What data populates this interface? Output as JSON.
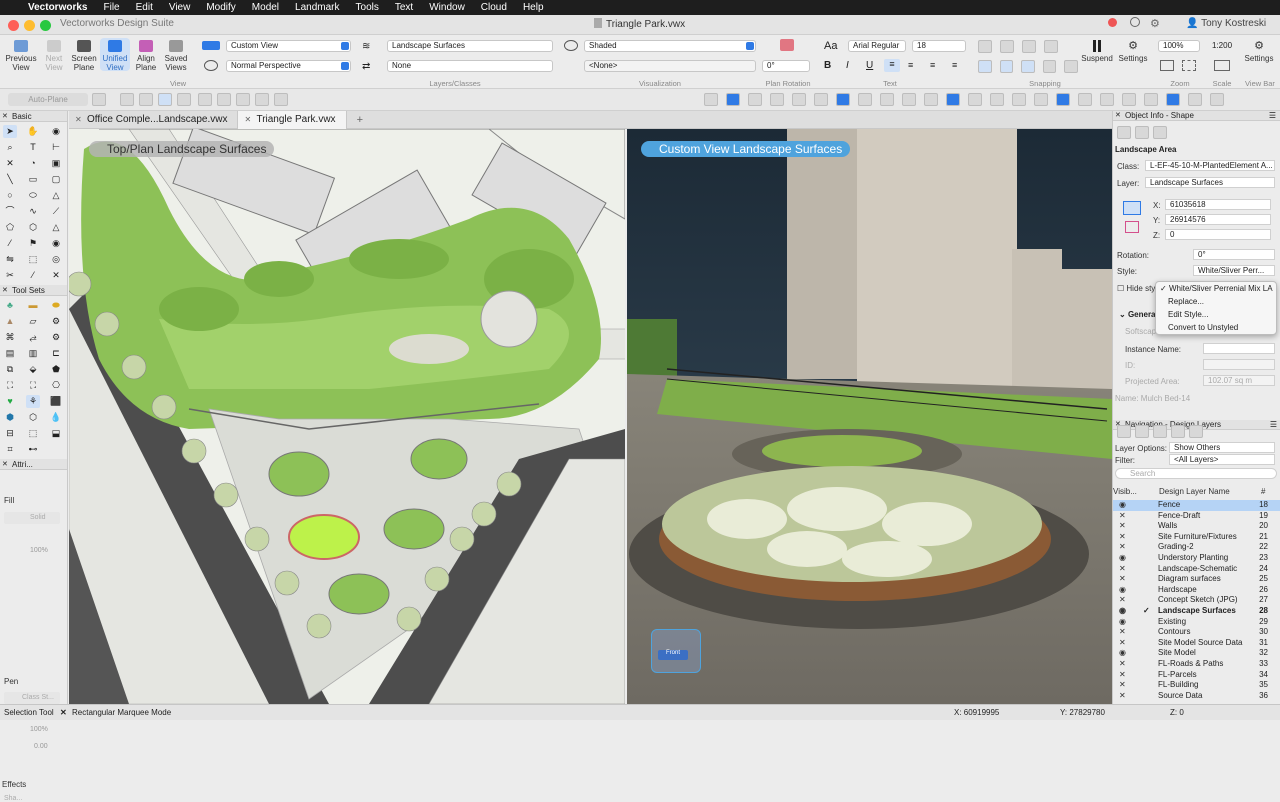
{
  "menubar": {
    "apple": "",
    "app": "Vectorworks",
    "items": [
      "File",
      "Edit",
      "View",
      "Modify",
      "Model",
      "Landmark",
      "Tools",
      "Text",
      "Window",
      "Cloud",
      "Help"
    ]
  },
  "titlebar": {
    "app_title": "Vectorworks Design Suite",
    "doc_title": "Triangle Park.vwx",
    "user": "Tony Kostreski"
  },
  "toolbar": {
    "previous": "Previous View",
    "next": "Next View",
    "screen": "Screen Plane",
    "unified": "Unified View",
    "align": "Align Plane",
    "saved": "Saved Views",
    "view_group": "View",
    "view_select": "Custom View",
    "projection_select": "Normal Perspective",
    "layer_select": "Landscape Surfaces",
    "class_select": "None",
    "layers_caption": "Layers/Classes",
    "render_select": "Shaded",
    "render_sub": "<None>",
    "vis_caption": "Visualization",
    "plan_rotation": "0°",
    "plan_rot_caption": "Plan Rotation",
    "font": "Arial Regular",
    "size": "18",
    "text_caption": "Text",
    "snapping_caption": "Snapping",
    "suspend": "Suspend",
    "settings": "Settings",
    "zoom": "100%",
    "zoom_caption": "Zoom",
    "scale": "1:200",
    "scale_caption": "Scale",
    "settings2": "Settings",
    "viewbar_caption": "View Bar"
  },
  "toolbar2": {
    "auto_plane": "Auto-Plane"
  },
  "left_palette": {
    "basic": "Basic",
    "toolsets": "Tool Sets",
    "attributes": "Attri...",
    "fill": "Fill",
    "fill_value": "Solid",
    "opacity": "100%",
    "pen": "Pen",
    "pen_value": "Class St...",
    "pen_opacity": "100%",
    "thickness": "0.00",
    "effects": "Effects",
    "effects_value": "Sha..."
  },
  "tabs": [
    {
      "label": "Office Comple...Landscape.vwx"
    },
    {
      "label": "Triangle Park.vwx"
    }
  ],
  "view2d": {
    "label": "Top/Plan  Landscape Surfaces"
  },
  "view3d": {
    "label": "Custom View  Landscape Surfaces",
    "cube": "Front"
  },
  "obj_info": {
    "title": "Object Info - Shape",
    "object": "Landscape Area",
    "class_lbl": "Class:",
    "class_val": "L-EF-45-10-M-PlantedElement A...",
    "layer_lbl": "Layer:",
    "layer_val": "Landscape Surfaces",
    "x_lbl": "X:",
    "x_val": "61035618",
    "y_lbl": "Y:",
    "y_val": "26914576",
    "z_lbl": "Z:",
    "z_val": "0",
    "rotation_lbl": "Rotation:",
    "rotation_val": "0°",
    "style_lbl": "Style:",
    "style_val": "White/Sliver Perr...",
    "hide_lbl": "Hide sty",
    "general": "General",
    "softscape": "Softscap",
    "instance_lbl": "Instance Name:",
    "id_lbl": "ID:",
    "area_lbl": "Projected Area:",
    "area_val": "102.07 sq m",
    "name_lbl": "Name:",
    "name_val": "Mulch Bed-14",
    "style_menu": [
      "White/Sliver Perrenial Mix LA",
      "Replace...",
      "Edit Style...",
      "Convert to Unstyled"
    ]
  },
  "navigation": {
    "title": "Navigation - Design Layers",
    "layer_options_lbl": "Layer Options:",
    "layer_options_val": "Show Others",
    "filter_lbl": "Filter:",
    "filter_val": "<All Layers>",
    "search_placeholder": "Search",
    "col_vis": "Visib...",
    "col_name": "Design Layer Name",
    "col_no": "#",
    "layers": [
      {
        "name": "Fence",
        "no": "18",
        "vis": "◉",
        "sel": true
      },
      {
        "name": "Fence-Draft",
        "no": "19",
        "vis": "✕"
      },
      {
        "name": "Walls",
        "no": "20",
        "vis": "✕"
      },
      {
        "name": "Site Furniture/Fixtures",
        "no": "21",
        "vis": "✕"
      },
      {
        "name": "Grading-2",
        "no": "22",
        "vis": "✕"
      },
      {
        "name": "Understory Planting",
        "no": "23",
        "vis": "◉"
      },
      {
        "name": "Landscape-Schematic",
        "no": "24",
        "vis": "✕"
      },
      {
        "name": "Diagram surfaces",
        "no": "25",
        "vis": "✕"
      },
      {
        "name": "Hardscape",
        "no": "26",
        "vis": "◉"
      },
      {
        "name": "Concept Sketch (JPG)",
        "no": "27",
        "vis": "✕"
      },
      {
        "name": "Landscape Surfaces",
        "no": "28",
        "vis": "◉",
        "active": true
      },
      {
        "name": "Existing",
        "no": "29",
        "vis": "◉"
      },
      {
        "name": "Contours",
        "no": "30",
        "vis": "✕"
      },
      {
        "name": "Site Model Source Data",
        "no": "31",
        "vis": "✕"
      },
      {
        "name": "Site Model",
        "no": "32",
        "vis": "◉"
      },
      {
        "name": "FL-Roads & Paths",
        "no": "33",
        "vis": "✕"
      },
      {
        "name": "FL-Parcels",
        "no": "34",
        "vis": "✕"
      },
      {
        "name": "FL-Building",
        "no": "35",
        "vis": "✕"
      },
      {
        "name": "Source Data",
        "no": "36",
        "vis": "✕"
      }
    ]
  },
  "status": {
    "tool": "Selection Tool",
    "mode": "Rectangular Marquee Mode",
    "x": "X: 60919995",
    "y": "Y: 27829780",
    "z": "Z: 0"
  },
  "colors": {
    "accent": "#2f7ae5",
    "green": "#7fb641",
    "selection": "#b5d3f5"
  }
}
